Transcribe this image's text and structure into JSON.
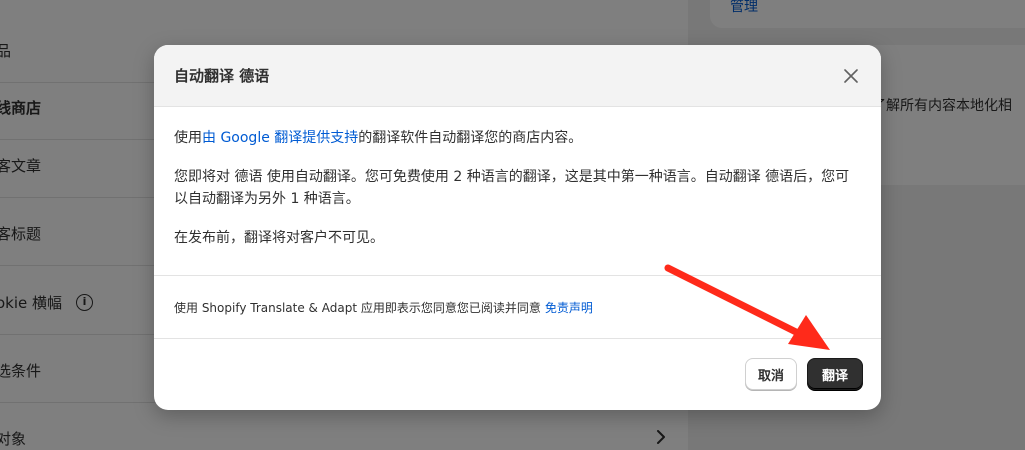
{
  "background": {
    "rows": [
      {
        "label": "品"
      },
      {
        "label": "线商店"
      },
      {
        "label": "客文章"
      },
      {
        "label": "客标题"
      },
      {
        "label": "okie 横幅"
      },
      {
        "label": "选条件"
      },
      {
        "label": "对象"
      }
    ],
    "right_link": "管理",
    "right_text": "了解所有内容本地化相"
  },
  "modal": {
    "title": "自动翻译 德语",
    "body": {
      "p1_prefix": "使用",
      "p1_link": "由 Google 翻译提供支持",
      "p1_suffix": "的翻译软件自动翻译您的商店内容。",
      "p2": "您即将对 德语 使用自动翻译。您可免费使用 2 种语言的翻译，这是其中第一种语言。自动翻译 德语后，您可以自动翻译为另外 1 种语言。",
      "p3": "在发布前，翻译将对客户不可见。"
    },
    "disclaimer": {
      "text": "使用 Shopify Translate & Adapt 应用即表示您同意您已阅读并同意",
      "link": "免责声明"
    },
    "buttons": {
      "cancel": "取消",
      "translate": "翻译"
    }
  },
  "colors": {
    "link": "#005bd3",
    "primary_button": "#303030",
    "annotation_arrow": "#ff2a1a"
  },
  "icons": {
    "close": "close-icon",
    "info": "info-icon",
    "chevron": "chevron-right-icon"
  }
}
